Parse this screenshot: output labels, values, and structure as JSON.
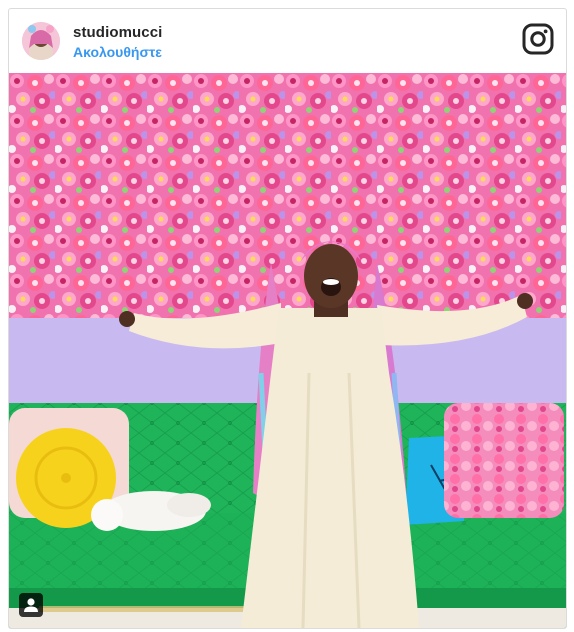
{
  "post": {
    "username": "studiomucci",
    "follow_label": "Ακολουθήστε"
  },
  "icons": {
    "brand": "instagram-icon",
    "tag": "user-tag-icon"
  },
  "colors": {
    "link": "#3897f0",
    "flower_pink": "#f25aa8",
    "wall_lavender": "#c9b8f0",
    "sofa_green": "#19b25a",
    "pillow_yellow": "#f7d21c",
    "pillow_blue": "#1fb3e8",
    "dress_cream": "#f3ead2"
  }
}
